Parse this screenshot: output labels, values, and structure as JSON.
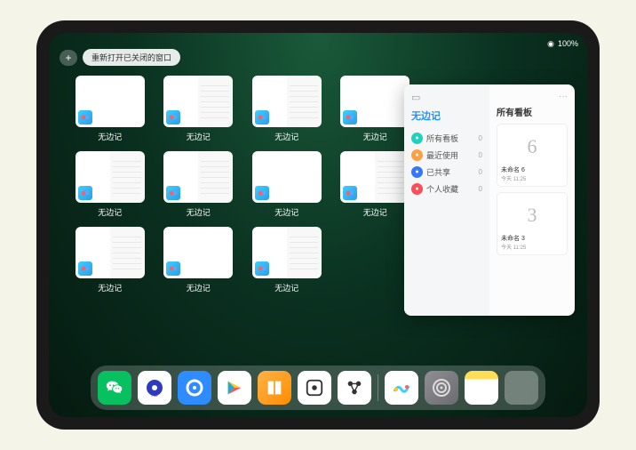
{
  "status": {
    "time": "",
    "battery": "100%"
  },
  "topbar": {
    "add": "+",
    "reopen": "重新打开已关闭的窗口"
  },
  "windows": [
    {
      "label": "无边记",
      "hasContent": false
    },
    {
      "label": "无边记",
      "hasContent": true
    },
    {
      "label": "无边记",
      "hasContent": true
    },
    {
      "label": "无边记",
      "hasContent": false
    },
    {
      "label": "无边记",
      "hasContent": true
    },
    {
      "label": "无边记",
      "hasContent": true
    },
    {
      "label": "无边记",
      "hasContent": false
    },
    {
      "label": "无边记",
      "hasContent": true
    },
    {
      "label": "无边记",
      "hasContent": true
    },
    {
      "label": "无边记",
      "hasContent": false
    },
    {
      "label": "无边记",
      "hasContent": true
    }
  ],
  "panel": {
    "title": "无边记",
    "nav": [
      {
        "icon": "teal",
        "label": "所有看板",
        "count": "0"
      },
      {
        "icon": "orange",
        "label": "最近使用",
        "count": "0"
      },
      {
        "icon": "blue",
        "label": "已共享",
        "count": "0"
      },
      {
        "icon": "red",
        "label": "个人收藏",
        "count": "0"
      }
    ],
    "rightTitle": "所有看板",
    "more": "···",
    "boards": [
      {
        "preview": "6",
        "name": "未命名 6",
        "date": "今天 11:25"
      },
      {
        "preview": "3",
        "name": "未命名 3",
        "date": "今天 11:25"
      }
    ]
  },
  "dock": {
    "apps": [
      "wechat",
      "quark-hd",
      "quark",
      "play",
      "books",
      "dots",
      "connect",
      "freeform",
      "settings",
      "notes",
      "folder"
    ]
  }
}
